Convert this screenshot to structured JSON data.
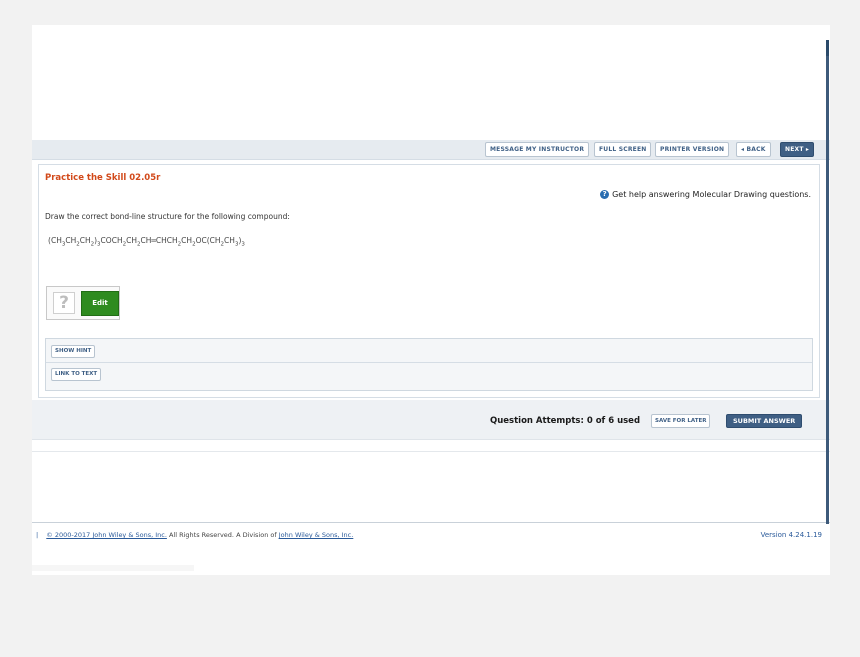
{
  "toolbar": {
    "message_instructor": "MESSAGE MY INSTRUCTOR",
    "full_screen": "FULL SCREEN",
    "printer_version": "PRINTER VERSION",
    "back": "◂ BACK",
    "next": "NEXT ▸"
  },
  "question": {
    "title": "Practice the Skill 02.05r",
    "help_text": "Get help answering Molecular Drawing questions.",
    "prompt": "Draw the correct bond-line structure for the following compound:",
    "compound": "(CH3CH2CH2)3COCH2CH2CH=CHCH2CH2OC(CH2CH3)3",
    "placeholder_glyph": "?",
    "edit_label": "Edit"
  },
  "hints": {
    "show_hint": "SHOW HINT",
    "link_to_text": "LINK TO TEXT"
  },
  "attempts": {
    "label": "Question Attempts: 0 of 6 used",
    "used": 0,
    "max": 6,
    "save_later": "SAVE FOR LATER",
    "submit": "SUBMIT ANSWER"
  },
  "footer": {
    "separator": "|",
    "copyright_link": "© 2000-2017 John Wiley & Sons, Inc.",
    "rights_text": "All Rights Reserved. A Division of",
    "company_link": "John Wiley & Sons, Inc.",
    "version": "Version 4.24.1.19"
  },
  "colors": {
    "title": "#d2491a",
    "toolbar_dark": "#3f5f84",
    "edit_button": "#2e8b1f",
    "link": "#2a5a9a"
  },
  "icons": {
    "help": "help-circle-icon",
    "placeholder": "question-mark-placeholder"
  }
}
